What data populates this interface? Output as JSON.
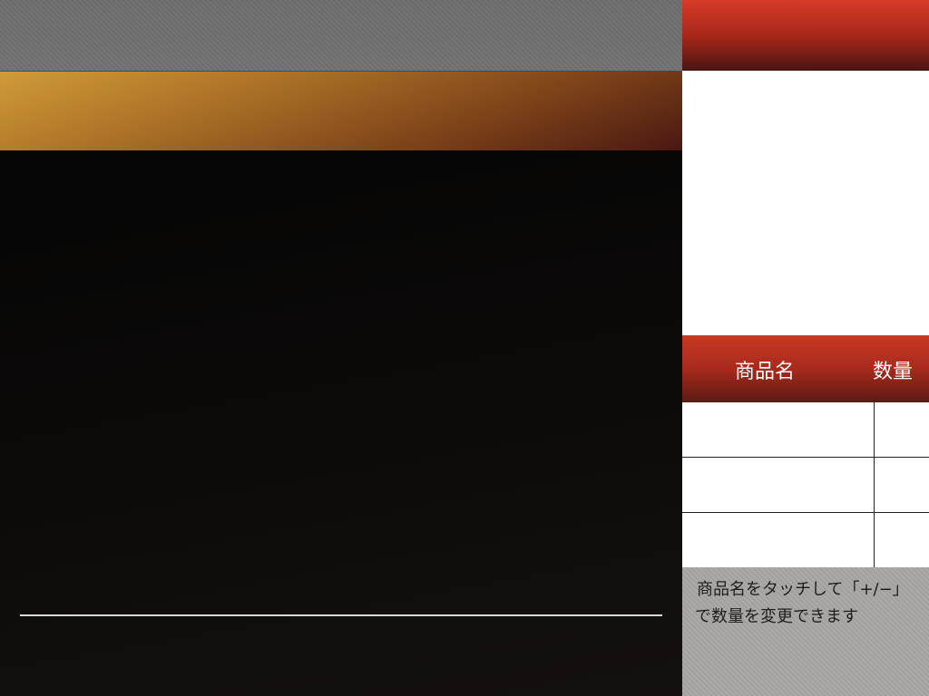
{
  "order_table": {
    "header": {
      "product_name_label": "商品名",
      "quantity_label": "数量"
    },
    "rows": [
      {
        "product_name": "",
        "quantity": ""
      },
      {
        "product_name": "",
        "quantity": ""
      },
      {
        "product_name": "",
        "quantity": ""
      }
    ]
  },
  "instructions": {
    "line1": "商品名をタッチして「+/−」",
    "line2": "で数量を変更できます"
  },
  "colors": {
    "accent_red": "#c93826",
    "category_gold": "#d19a3a",
    "panel_gray": "#a9a6a3"
  }
}
